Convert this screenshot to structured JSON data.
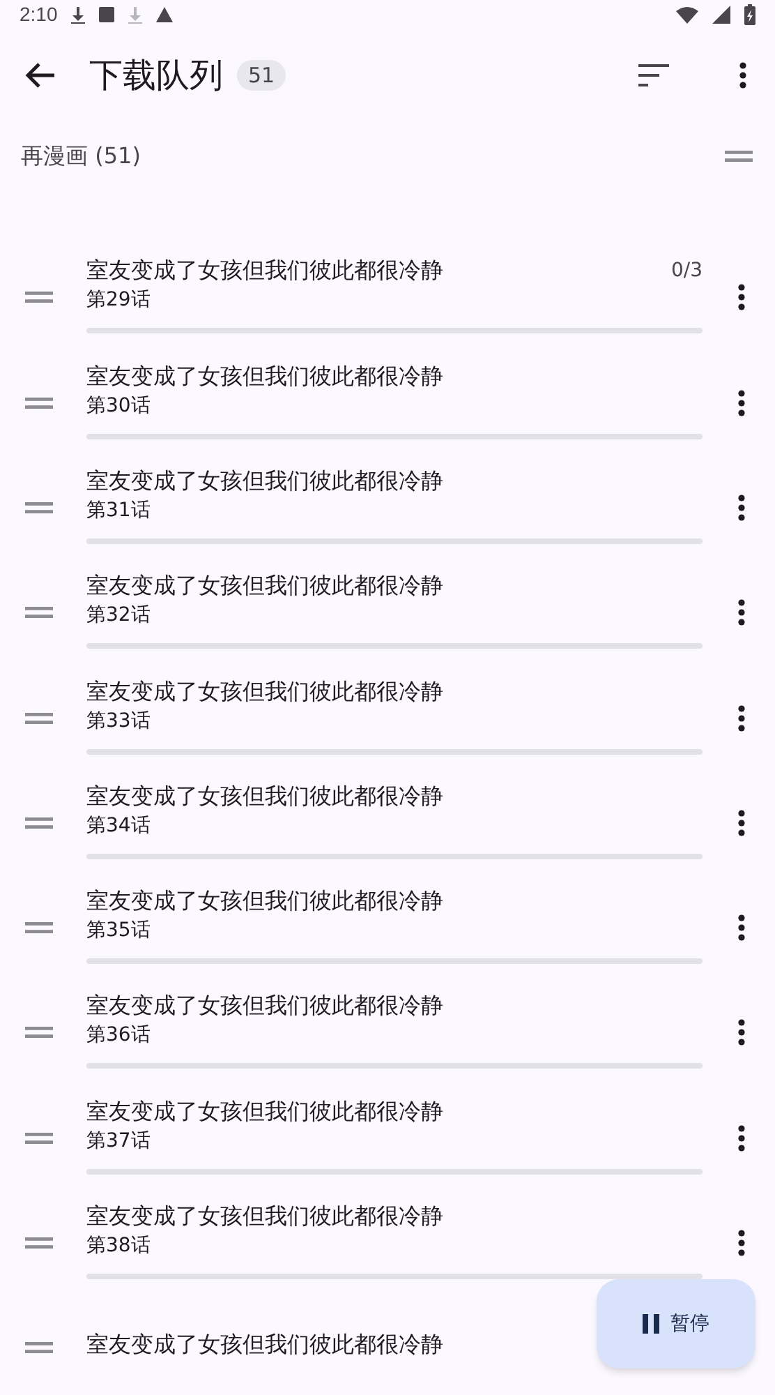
{
  "status_bar": {
    "time": "2:10"
  },
  "app_bar": {
    "title": "下载队列",
    "count": "51"
  },
  "category": {
    "label": "再漫画 (51)"
  },
  "items": [
    {
      "title": "室友变成了女孩但我们彼此都很冷静",
      "chapter": "第29话",
      "progress": "0/3"
    },
    {
      "title": "室友变成了女孩但我们彼此都很冷静",
      "chapter": "第30话"
    },
    {
      "title": "室友变成了女孩但我们彼此都很冷静",
      "chapter": "第31话"
    },
    {
      "title": "室友变成了女孩但我们彼此都很冷静",
      "chapter": "第32话"
    },
    {
      "title": "室友变成了女孩但我们彼此都很冷静",
      "chapter": "第33话"
    },
    {
      "title": "室友变成了女孩但我们彼此都很冷静",
      "chapter": "第34话"
    },
    {
      "title": "室友变成了女孩但我们彼此都很冷静",
      "chapter": "第35话"
    },
    {
      "title": "室友变成了女孩但我们彼此都很冷静",
      "chapter": "第36话"
    },
    {
      "title": "室友变成了女孩但我们彼此都很冷静",
      "chapter": "第37话"
    },
    {
      "title": "室友变成了女孩但我们彼此都很冷静",
      "chapter": "第38话"
    },
    {
      "title": "室友变成了女孩但我们彼此都很冷静"
    }
  ],
  "fab": {
    "label": "暂停"
  }
}
